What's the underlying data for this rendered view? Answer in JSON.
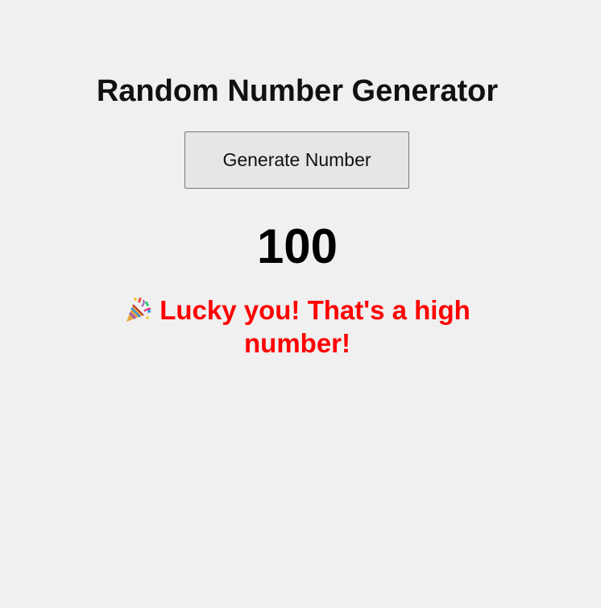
{
  "page": {
    "title": "Random Number Generator",
    "generate_button_label": "Generate Number",
    "result_number": "100",
    "message": {
      "text": "Lucky you! That's a high number!",
      "icon": "party-popper-icon",
      "color": "#ff0000"
    }
  },
  "colors": {
    "background": "#f0f0f0",
    "button_bg": "#e6e6e6",
    "button_border": "#767676",
    "message": "#ff0000"
  }
}
